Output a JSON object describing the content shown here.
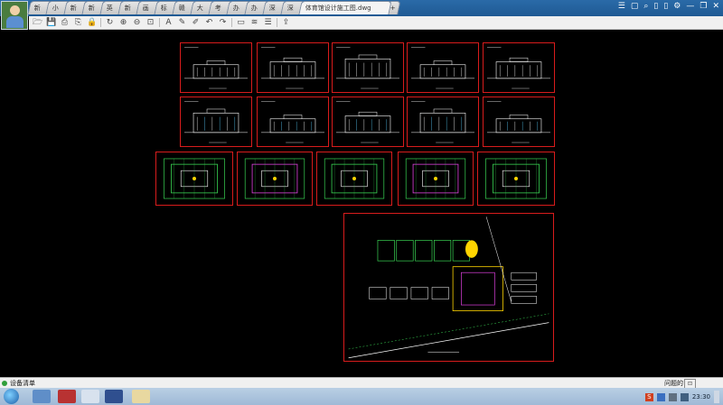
{
  "window": {
    "tabs": [
      "新",
      "小",
      "新",
      "新",
      "英",
      "新",
      "画",
      "标",
      "赣",
      "大",
      "考",
      "办",
      "办",
      "深",
      "深"
    ],
    "active_tab": "体育馆设计施工图.dwg",
    "plus": "+",
    "controls": [
      "☰",
      "▢",
      "⌕",
      "▯",
      "▯",
      "⚙",
      "—",
      "❐",
      "✕"
    ]
  },
  "toolbar": {
    "icons": [
      "folder-open-icon",
      "save-icon",
      "print-icon",
      "print-preview-icon",
      "lock-icon",
      "rotate-left-icon",
      "zoom-in-icon",
      "zoom-out-icon",
      "zoom-fit-icon",
      "text-icon",
      "pencil-icon",
      "marker-icon",
      "undo-icon",
      "redo-icon",
      "measure-icon",
      "layers-icon",
      "stack-icon",
      "export-icon"
    ],
    "glyphs": [
      "🗁",
      "💾",
      "⎙",
      "⎘",
      "🔒",
      "↻",
      "⊕",
      "⊖",
      "⊡",
      "A",
      "✎",
      "✐",
      "↶",
      "↷",
      "▭",
      "≋",
      "☰",
      "⇪"
    ]
  },
  "status": {
    "left_label": "设备清单",
    "right_label": "问题的",
    "button_glyph": "⊡"
  },
  "taskbar": {
    "time": "23:30",
    "tray_label": "S"
  },
  "colors": {
    "frame": "#d81c1c",
    "line_white": "#ffffff",
    "line_green": "#39d353",
    "line_magenta": "#e040e0",
    "line_yellow": "#ffd400",
    "line_cyan": "#5ad0ff"
  }
}
